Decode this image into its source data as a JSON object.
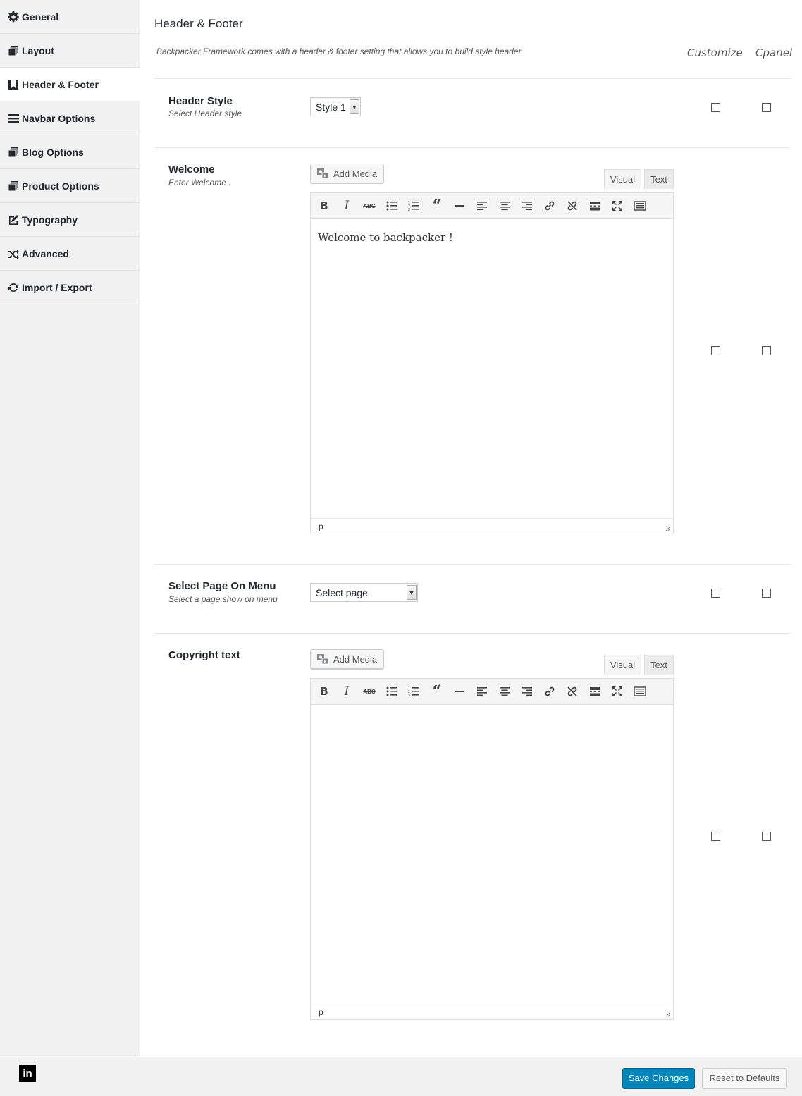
{
  "sidebar": {
    "items": [
      {
        "label": "General",
        "icon": "gear-icon"
      },
      {
        "label": "Layout",
        "icon": "copy-icon"
      },
      {
        "label": "Header & Footer",
        "icon": "book-icon"
      },
      {
        "label": "Navbar Options",
        "icon": "bars-icon"
      },
      {
        "label": "Blog Options",
        "icon": "copy-icon"
      },
      {
        "label": "Product Options",
        "icon": "copy-icon"
      },
      {
        "label": "Typography",
        "icon": "edit-icon"
      },
      {
        "label": "Advanced",
        "icon": "shuffle-icon"
      },
      {
        "label": "Import / Export",
        "icon": "refresh-icon"
      }
    ],
    "active": "Header & Footer"
  },
  "main": {
    "title": "Header & Footer",
    "description": "Backpacker Framework comes with a header & footer setting that allows you to build style header.",
    "columns": {
      "customize": "Customize",
      "cpanel": "Cpanel"
    }
  },
  "fields": {
    "header_style": {
      "label": "Header Style",
      "sub": "Select Header style",
      "value": "Style 1"
    },
    "welcome": {
      "label": "Welcome",
      "sub": "Enter Welcome .",
      "content": "Welcome to backpacker !",
      "path": "p"
    },
    "select_page": {
      "label": "Select Page On Menu",
      "sub": "Select a page show on menu",
      "value": "Select page"
    },
    "copyright": {
      "label": "Copyright text",
      "content": "",
      "path": "p"
    }
  },
  "editor": {
    "add_media": "Add Media",
    "tab_visual": "Visual",
    "tab_text": "Text"
  },
  "footer": {
    "save": "Save Changes",
    "reset": "Reset to Defaults",
    "social": "in"
  },
  "colors": {
    "primary": "#0085ba",
    "sidebar_bg": "#f1f1f1"
  }
}
